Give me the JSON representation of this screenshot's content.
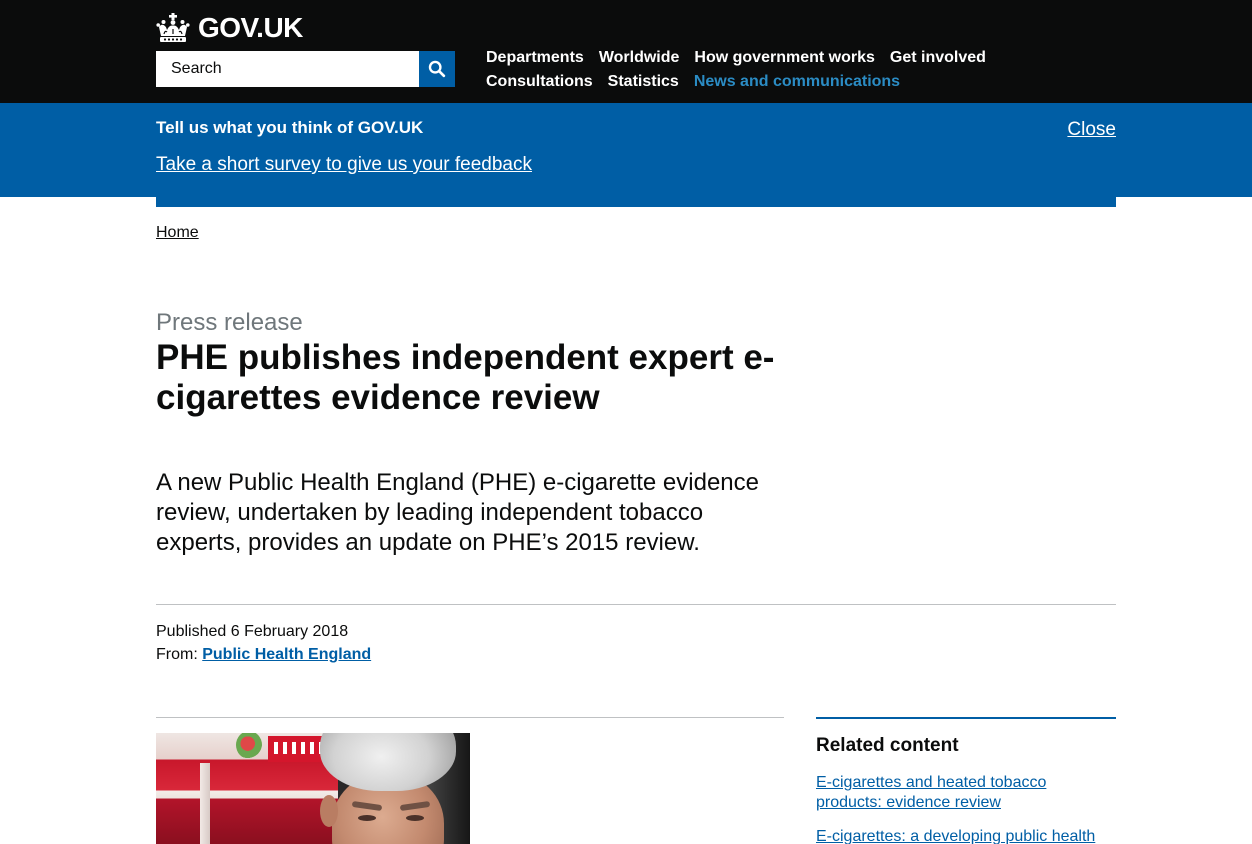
{
  "header": {
    "logo_text": "GOV.UK",
    "logo_icon": "crown-icon",
    "search": {
      "placeholder": "Search",
      "button_icon": "search-icon"
    },
    "nav": [
      {
        "label": "Departments",
        "active": false
      },
      {
        "label": "Worldwide",
        "active": false
      },
      {
        "label": "How government works",
        "active": false
      },
      {
        "label": "Get involved",
        "active": false
      },
      {
        "label": "Consultations",
        "active": false
      },
      {
        "label": "Statistics",
        "active": false
      },
      {
        "label": "News and communications",
        "active": true
      }
    ]
  },
  "survey_banner": {
    "title": "Tell us what you think of GOV.UK",
    "link": "Take a short survey to give us your feedback",
    "close": "Close"
  },
  "breadcrumb": [
    {
      "label": "Home"
    }
  ],
  "article": {
    "type": "Press release",
    "title": "PHE publishes independent expert e-cigarettes evidence review",
    "summary": "A new Public Health England (PHE) e-cigarette evidence review, undertaken by leading independent tobacco experts, provides an update on PHE’s 2015 review.",
    "published": "Published 6 February 2018",
    "from_label": "From:",
    "from_org": "Public Health England"
  },
  "related_content": {
    "heading": "Related content",
    "links": [
      {
        "label": "E-cigarettes and heated tobacco products: evidence review"
      },
      {
        "label": "E-cigarettes: a developing public health"
      }
    ]
  },
  "colors": {
    "header_bg": "#0b0c0c",
    "brand_blue": "#005ea5",
    "nav_active": "#2b8cc4",
    "text": "#0b0c0c",
    "secondary_text": "#6f777b",
    "link": "#005ea5",
    "border": "#bfc1c3"
  }
}
